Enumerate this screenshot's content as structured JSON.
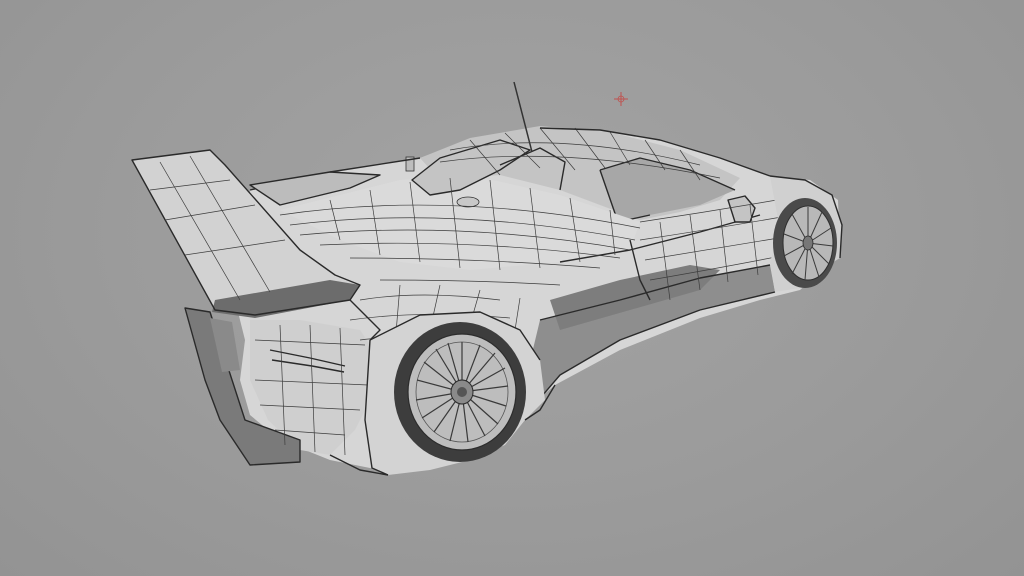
{
  "viewport": {
    "background_color": "#9e9e9e",
    "wireframe_color": "#3c3c3c",
    "surface_color": "#d4d4d4",
    "cursor_color": "#c0504d"
  },
  "scene": {
    "subject": "race-car-3d-wireframe-model",
    "icons": [
      "3d-cursor-icon"
    ]
  }
}
